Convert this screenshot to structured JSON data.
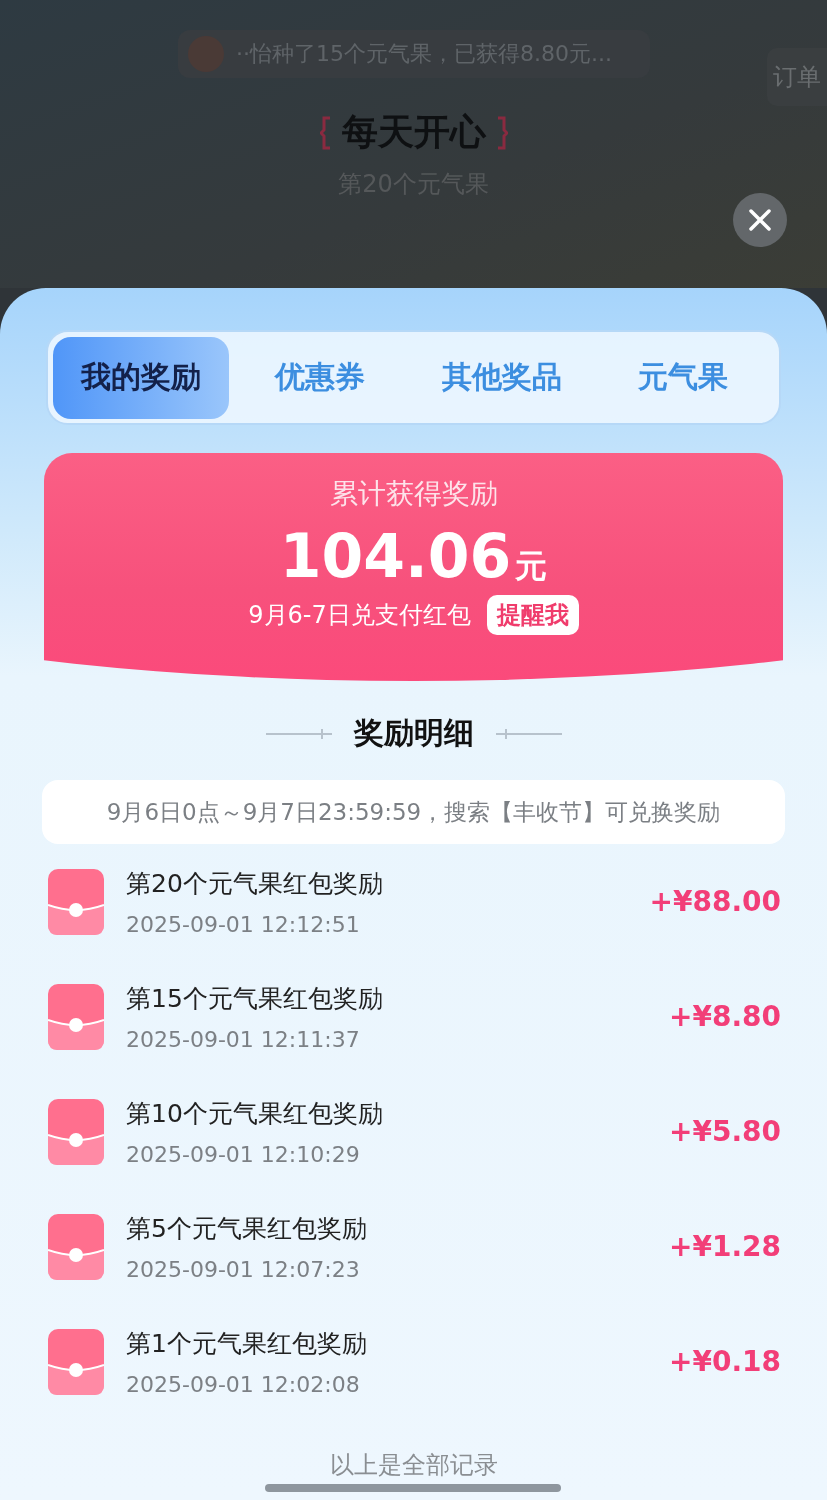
{
  "background": {
    "ticker": "··怡种了15个元气果，已获得8.80元...",
    "order_link": "订单",
    "title": "每天开心",
    "subtitle": "第20个元气果"
  },
  "tabs": [
    {
      "label": "我的奖励",
      "selected": true
    },
    {
      "label": "优惠券",
      "selected": false
    },
    {
      "label": "其他奖品",
      "selected": false
    },
    {
      "label": "元气果",
      "selected": false
    }
  ],
  "summary": {
    "label": "累计获得奖励",
    "amount": "104.06",
    "unit": "元",
    "note": "9月6-7日兑支付红包",
    "remind_button": "提醒我"
  },
  "details": {
    "title": "奖励明细",
    "notice": "9月6日0点～9月7日23:59:59，搜索【丰收节】可兑换奖励",
    "rows": [
      {
        "title": "第20个元气果红包奖励",
        "time": "2025-09-01 12:12:51",
        "amount": "+¥88.00"
      },
      {
        "title": "第15个元气果红包奖励",
        "time": "2025-09-01 12:11:37",
        "amount": "+¥8.80"
      },
      {
        "title": "第10个元气果红包奖励",
        "time": "2025-09-01 12:10:29",
        "amount": "+¥5.80"
      },
      {
        "title": "第5个元气果红包奖励",
        "time": "2025-09-01 12:07:23",
        "amount": "+¥1.28"
      },
      {
        "title": "第1个元气果红包奖励",
        "time": "2025-09-01 12:02:08",
        "amount": "+¥0.18"
      }
    ],
    "footer": "以上是全部记录"
  }
}
